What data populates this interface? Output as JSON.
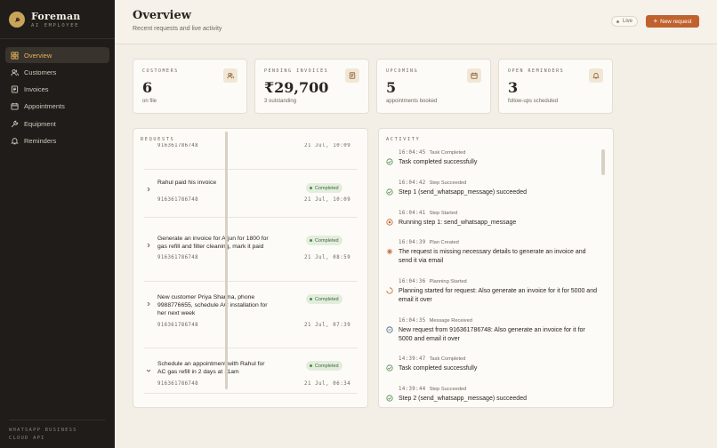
{
  "brand": {
    "name": "Foreman",
    "subtitle": "AI EMPLOYEE"
  },
  "sidebar": {
    "items": [
      {
        "label": "Overview",
        "icon": "grid-icon",
        "active": true
      },
      {
        "label": "Customers",
        "icon": "users-icon",
        "active": false
      },
      {
        "label": "Invoices",
        "icon": "invoice-icon",
        "active": false
      },
      {
        "label": "Appointments",
        "icon": "calendar-icon",
        "active": false
      },
      {
        "label": "Equipment",
        "icon": "wrench-icon",
        "active": false
      },
      {
        "label": "Reminders",
        "icon": "bell-icon",
        "active": false
      }
    ],
    "footer": "WHATSAPP BUSINESS CLOUD API"
  },
  "header": {
    "title": "Overview",
    "subtitle": "Recent requests and live activity",
    "live_label": "Live",
    "new_request_label": "New request"
  },
  "stats": [
    {
      "label": "CUSTOMERS",
      "value": "6",
      "sub": "on file",
      "icon": "users-icon"
    },
    {
      "label": "PENDING INVOICES",
      "value": "₹29,700",
      "sub": "3 outstanding",
      "icon": "invoice-icon"
    },
    {
      "label": "UPCOMING",
      "value": "5",
      "sub": "appointments booked",
      "icon": "calendar-icon"
    },
    {
      "label": "OPEN REMINDERS",
      "value": "3",
      "sub": "follow-ups scheduled",
      "icon": "bell-icon"
    }
  ],
  "requests": {
    "title": "REQUESTS",
    "partial_top": {
      "phone": "916361786748",
      "time": "21 Jul, 10:09"
    },
    "items": [
      {
        "text": "Rahul paid his invoice",
        "phone": "916361786748",
        "time": "21 Jul, 10:09",
        "status": "Completed"
      },
      {
        "text": "Generate an invoice for Arjun for 1800 for gas refill and filter cleaning, mark it paid",
        "phone": "916361786748",
        "time": "21 Jul, 08:59",
        "status": "Completed"
      },
      {
        "text": "New customer Priya Sharma, phone 9988776655, schedule AC installation for her next week",
        "phone": "916361786748",
        "time": "21 Jul, 07:39",
        "status": "Completed"
      },
      {
        "text": "Schedule an appointment with Rahul for AC gas refill in 2 days at 11am",
        "phone": "916361786748",
        "time": "21 Jul, 06:34",
        "status": "Completed"
      }
    ]
  },
  "activity": {
    "title": "ACTIVITY",
    "items": [
      {
        "time": "16:04:45",
        "tag": "Task Completed",
        "text": "Task completed successfully",
        "icon": "check-circle-icon"
      },
      {
        "time": "16:04:42",
        "tag": "Step Succeeded",
        "text": "Step 1 (send_whatsapp_message) succeeded",
        "icon": "check-circle-icon"
      },
      {
        "time": "16:04:41",
        "tag": "Step Started",
        "text": "Running step 1: send_whatsapp_message",
        "icon": "target-icon"
      },
      {
        "time": "16:04:39",
        "tag": "Plan Created",
        "text": "The request is missing necessary details to generate an invoice and send it via email",
        "icon": "plan-icon"
      },
      {
        "time": "16:04:36",
        "tag": "Planning Started",
        "text": "Planning started for request: Also generate an invoice for it for 5000 and email it over",
        "icon": "loader-icon"
      },
      {
        "time": "16:04:35",
        "tag": "Message Received",
        "text": "New request from 916361786748: Also generate an invoice for it for 5000 and email it over",
        "icon": "message-icon"
      },
      {
        "time": "14:39:47",
        "tag": "Task Completed",
        "text": "Task completed successfully",
        "icon": "check-circle-icon"
      },
      {
        "time": "14:39:44",
        "tag": "Step Succeeded",
        "text": "Step 2 (send_whatsapp_message) succeeded",
        "icon": "check-circle-icon"
      }
    ]
  },
  "colors": {
    "accent": "#c0622d",
    "sidebar_bg": "#1f1c19",
    "active_nav": "#e9b25a",
    "success": "#4e8848",
    "page_bg": "#f3efe6"
  }
}
